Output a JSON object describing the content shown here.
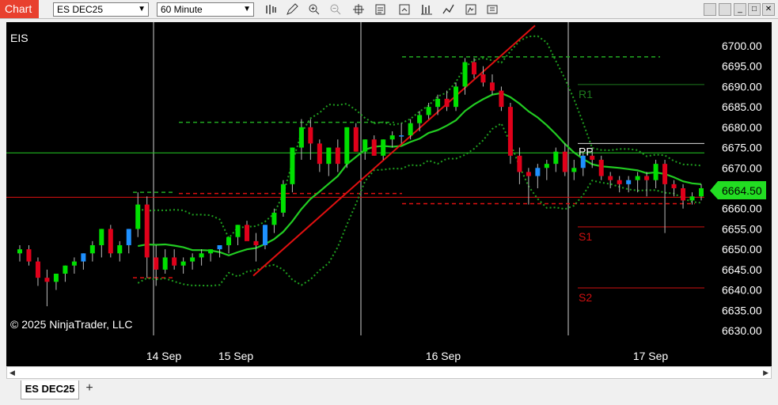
{
  "toolbar": {
    "chart_label": "Chart",
    "instrument": "ES DEC25",
    "interval": "60 Minute",
    "icons": [
      "bar-type-icon",
      "draw-pencil-icon",
      "zoom-in-icon",
      "zoom-out-icon",
      "crosshair-icon",
      "data-box-icon",
      "properties-icon",
      "indicators-icon",
      "strategies-icon",
      "templates-icon",
      "share-icon"
    ]
  },
  "chart": {
    "symbol_label": "EIS",
    "copyright": "© 2025 NinjaTrader, LLC",
    "last_price": "6664.50",
    "colors": {
      "up": "#00e000",
      "down": "#e0001a",
      "up_alt": "#1e90ff",
      "ma": "#22cc22",
      "band": "#1fa01f",
      "pivot_r": "#1e7a1e",
      "pivot_s": "#d01010",
      "last_tag": "#22dd22"
    },
    "pivots": {
      "r1": "R1",
      "pp": "PP",
      "s1": "S1",
      "s2": "S2"
    }
  },
  "chart_data": {
    "type": "candlestick",
    "y_ticks": [
      "6700.00",
      "6695.00",
      "6690.00",
      "6685.00",
      "6680.00",
      "6675.00",
      "6670.00",
      "6665.00",
      "6660.00",
      "6655.00",
      "6650.00",
      "6645.00",
      "6640.00",
      "6635.00",
      "6630.00"
    ],
    "x_ticks": [
      "14 Sep",
      "15 Sep",
      "16 Sep",
      "17 Sep"
    ],
    "ylim": [
      6627,
      6704
    ],
    "pivot_levels": {
      "r1": 6690.5,
      "pp": 6676.0,
      "s1": 6655.5,
      "s2": 6640.5
    },
    "candles": [
      {
        "o": 6649,
        "h": 6651,
        "l": 6647,
        "c": 6650
      },
      {
        "o": 6650,
        "h": 6651,
        "l": 6646,
        "c": 6647
      },
      {
        "o": 6647,
        "h": 6648,
        "l": 6641,
        "c": 6643
      },
      {
        "o": 6643,
        "h": 6645,
        "l": 6636,
        "c": 6642
      },
      {
        "o": 6642,
        "h": 6644,
        "l": 6640,
        "c": 6644
      },
      {
        "o": 6644,
        "h": 6646,
        "l": 6642,
        "c": 6646
      },
      {
        "o": 6646,
        "h": 6648,
        "l": 6644,
        "c": 6647
      },
      {
        "o": 6647,
        "h": 6649,
        "l": 6645,
        "c": 6649
      },
      {
        "o": 6649,
        "h": 6652,
        "l": 6647,
        "c": 6651
      },
      {
        "o": 6651,
        "h": 6655,
        "l": 6648,
        "c": 6655
      },
      {
        "o": 6655,
        "h": 6656,
        "l": 6648,
        "c": 6649
      },
      {
        "o": 6649,
        "h": 6652,
        "l": 6647,
        "c": 6651
      },
      {
        "o": 6651,
        "h": 6655,
        "l": 6649,
        "c": 6655
      },
      {
        "o": 6655,
        "h": 6664,
        "l": 6653,
        "c": 6661
      },
      {
        "o": 6661,
        "h": 6663,
        "l": 6643,
        "c": 6648
      },
      {
        "o": 6648,
        "h": 6651,
        "l": 6641,
        "c": 6645
      },
      {
        "o": 6645,
        "h": 6650,
        "l": 6644,
        "c": 6648
      },
      {
        "o": 6648,
        "h": 6650,
        "l": 6645,
        "c": 6646
      },
      {
        "o": 6646,
        "h": 6648,
        "l": 6644,
        "c": 6647
      },
      {
        "o": 6647,
        "h": 6649,
        "l": 6645,
        "c": 6648
      },
      {
        "o": 6648,
        "h": 6650,
        "l": 6646,
        "c": 6649
      },
      {
        "o": 6649,
        "h": 6650,
        "l": 6647,
        "c": 6650
      },
      {
        "o": 6650,
        "h": 6651,
        "l": 6648,
        "c": 6651
      },
      {
        "o": 6651,
        "h": 6653,
        "l": 6649,
        "c": 6653
      },
      {
        "o": 6653,
        "h": 6656,
        "l": 6651,
        "c": 6656
      },
      {
        "o": 6656,
        "h": 6657,
        "l": 6653,
        "c": 6652
      },
      {
        "o": 6652,
        "h": 6654,
        "l": 6647,
        "c": 6651
      },
      {
        "o": 6651,
        "h": 6656,
        "l": 6650,
        "c": 6656
      },
      {
        "o": 6656,
        "h": 6660,
        "l": 6654,
        "c": 6659
      },
      {
        "o": 6659,
        "h": 6667,
        "l": 6658,
        "c": 6666
      },
      {
        "o": 6666,
        "h": 6675,
        "l": 6664,
        "c": 6675
      },
      {
        "o": 6675,
        "h": 6682,
        "l": 6672,
        "c": 6680
      },
      {
        "o": 6680,
        "h": 6682,
        "l": 6672,
        "c": 6676
      },
      {
        "o": 6676,
        "h": 6677,
        "l": 6669,
        "c": 6671
      },
      {
        "o": 6671,
        "h": 6675,
        "l": 6668,
        "c": 6675
      },
      {
        "o": 6675,
        "h": 6677,
        "l": 6669,
        "c": 6671
      },
      {
        "o": 6671,
        "h": 6680,
        "l": 6670,
        "c": 6680
      },
      {
        "o": 6680,
        "h": 6681,
        "l": 6674,
        "c": 6674
      },
      {
        "o": 6674,
        "h": 6677,
        "l": 6672,
        "c": 6677
      },
      {
        "o": 6677,
        "h": 6678,
        "l": 6673,
        "c": 6673
      },
      {
        "o": 6673,
        "h": 6677,
        "l": 6672,
        "c": 6677
      },
      {
        "o": 6677,
        "h": 6679,
        "l": 6675,
        "c": 6678
      },
      {
        "o": 6678,
        "h": 6681,
        "l": 6676,
        "c": 6678
      },
      {
        "o": 6678,
        "h": 6682,
        "l": 6677,
        "c": 6681
      },
      {
        "o": 6681,
        "h": 6684,
        "l": 6679,
        "c": 6683
      },
      {
        "o": 6683,
        "h": 6686,
        "l": 6682,
        "c": 6685
      },
      {
        "o": 6685,
        "h": 6688,
        "l": 6683,
        "c": 6687
      },
      {
        "o": 6687,
        "h": 6689,
        "l": 6684,
        "c": 6685
      },
      {
        "o": 6685,
        "h": 6691,
        "l": 6684,
        "c": 6690
      },
      {
        "o": 6690,
        "h": 6697,
        "l": 6688,
        "c": 6696
      },
      {
        "o": 6696,
        "h": 6697,
        "l": 6692,
        "c": 6693
      },
      {
        "o": 6693,
        "h": 6695,
        "l": 6690,
        "c": 6691
      },
      {
        "o": 6691,
        "h": 6693,
        "l": 6688,
        "c": 6689
      },
      {
        "o": 6689,
        "h": 6690,
        "l": 6684,
        "c": 6685
      },
      {
        "o": 6685,
        "h": 6686,
        "l": 6671,
        "c": 6673
      },
      {
        "o": 6673,
        "h": 6675,
        "l": 6666,
        "c": 6669
      },
      {
        "o": 6669,
        "h": 6670,
        "l": 6661,
        "c": 6668
      },
      {
        "o": 6668,
        "h": 6671,
        "l": 6665,
        "c": 6670
      },
      {
        "o": 6670,
        "h": 6672,
        "l": 6667,
        "c": 6671
      },
      {
        "o": 6671,
        "h": 6675,
        "l": 6669,
        "c": 6674
      },
      {
        "o": 6674,
        "h": 6676,
        "l": 6668,
        "c": 6669
      },
      {
        "o": 6669,
        "h": 6672,
        "l": 6667,
        "c": 6670
      },
      {
        "o": 6670,
        "h": 6674,
        "l": 6668,
        "c": 6673
      },
      {
        "o": 6673,
        "h": 6675,
        "l": 6670,
        "c": 6672
      },
      {
        "o": 6672,
        "h": 6673,
        "l": 6667,
        "c": 6668
      },
      {
        "o": 6668,
        "h": 6669,
        "l": 6665,
        "c": 6667
      },
      {
        "o": 6667,
        "h": 6668,
        "l": 6664,
        "c": 6666
      },
      {
        "o": 6666,
        "h": 6668,
        "l": 6664,
        "c": 6667
      },
      {
        "o": 6667,
        "h": 6669,
        "l": 6664,
        "c": 6668
      },
      {
        "o": 6668,
        "h": 6669,
        "l": 6663,
        "c": 6667
      },
      {
        "o": 6667,
        "h": 6672,
        "l": 6665,
        "c": 6671
      },
      {
        "o": 6671,
        "h": 6672,
        "l": 6654,
        "c": 6666
      },
      {
        "o": 6666,
        "h": 6667,
        "l": 6663,
        "c": 6665
      },
      {
        "o": 6665,
        "h": 6666,
        "l": 6660,
        "c": 6662
      },
      {
        "o": 6662,
        "h": 6664,
        "l": 6661,
        "c": 6663
      },
      {
        "o": 6663,
        "h": 6666,
        "l": 6662,
        "c": 6665
      }
    ]
  }
}
